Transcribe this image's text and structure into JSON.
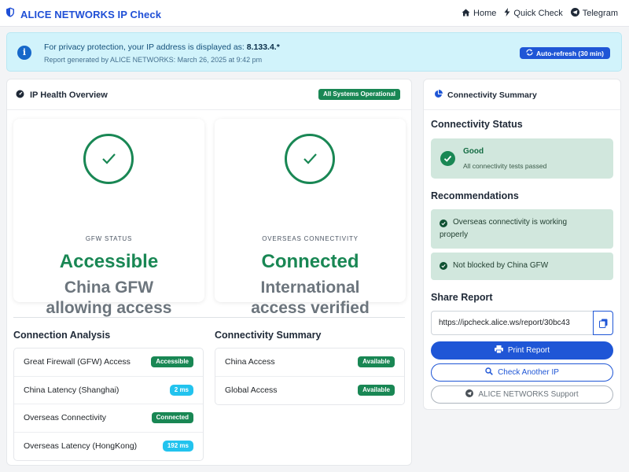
{
  "header": {
    "title": "ALICE NETWORKS IP Check",
    "nav": [
      {
        "label": "Home",
        "icon": "home-icon"
      },
      {
        "label": "Quick Check",
        "icon": "bolt-icon"
      },
      {
        "label": "Telegram",
        "icon": "telegram-icon"
      }
    ]
  },
  "alert": {
    "line1_prefix": "For privacy protection, your IP address is displayed as: ",
    "ip": "8.133.4.*",
    "line2": "Report generated by ALICE NETWORKS: March 26, 2025 at 9:42 pm",
    "refresh_label": "Auto-refresh (30 min)"
  },
  "overview": {
    "title": "IP Health Overview",
    "badge": "All Systems Operational",
    "gfw": {
      "label": "GFW STATUS",
      "value": "Accessible",
      "desc1": "China GFW",
      "desc2": "allowing access"
    },
    "overseas": {
      "label": "OVERSEAS CONNECTIVITY",
      "value": "Connected",
      "desc1": "International",
      "desc2": "access verified"
    }
  },
  "analysis": {
    "title": "Connection Analysis",
    "rows": [
      {
        "label": "Great Firewall (GFW) Access",
        "badge": "Accessible"
      },
      {
        "label": "China Latency (Shanghai)",
        "badge": "2 ms"
      },
      {
        "label": "Overseas Connectivity",
        "badge": "Connected"
      },
      {
        "label": "Overseas Latency (HongKong)",
        "badge": "192 ms"
      }
    ]
  },
  "summary": {
    "title": "Connectivity Summary",
    "rows": [
      {
        "label": "China Access",
        "badge": "Available"
      },
      {
        "label": "Global Access",
        "badge": "Available"
      }
    ]
  },
  "side": {
    "title": "Connectivity Summary",
    "status_heading": "Connectivity Status",
    "status_title": "Good",
    "status_sub": "All connectivity tests passed",
    "rec_heading": "Recommendations",
    "rec1_line1": "Overseas connectivity is working",
    "rec1_line2": "properly",
    "rec2": "Not blocked by China GFW",
    "share_heading": "Share Report",
    "share_url": "https://ipcheck.alice.ws/report/30bc43",
    "print_label": "Print Report",
    "check_label": "Check Another IP",
    "support_label": "ALICE NETWORKS Support"
  },
  "colors": {
    "primary": "#1f56d6",
    "success": "#198754",
    "info": "#22c3ee",
    "alert_bg": "#d1f3fb",
    "success_bg": "#d1e7dd"
  }
}
